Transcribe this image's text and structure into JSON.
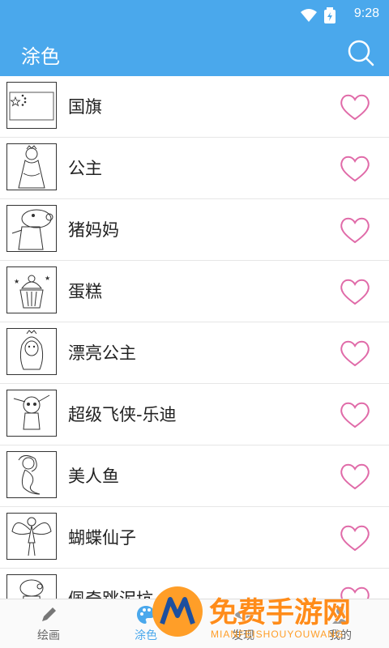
{
  "status": {
    "time": "9:28"
  },
  "appbar": {
    "title": "涂色"
  },
  "list": [
    {
      "label": "国旗",
      "thumb": "flag"
    },
    {
      "label": "公主",
      "thumb": "princess"
    },
    {
      "label": "猪妈妈",
      "thumb": "pig"
    },
    {
      "label": "蛋糕",
      "thumb": "cake"
    },
    {
      "label": "漂亮公主",
      "thumb": "princess2"
    },
    {
      "label": "超级飞侠-乐迪",
      "thumb": "robot"
    },
    {
      "label": "美人鱼",
      "thumb": "mermaid"
    },
    {
      "label": "蝴蝶仙子",
      "thumb": "fairy"
    },
    {
      "label": "佩奇跳泥坑",
      "thumb": "peppa"
    }
  ],
  "nav": {
    "tab1": "绘画",
    "tab2": "涂色",
    "tab3": "发现",
    "tab4": "我的"
  },
  "colors": {
    "primary": "#4aa8ec",
    "heart": "#e06aa8",
    "watermark": "#ff8c1a"
  },
  "watermark": {
    "text": "免费手游网",
    "sub": "MIANFEISHOUYOUWANG"
  }
}
